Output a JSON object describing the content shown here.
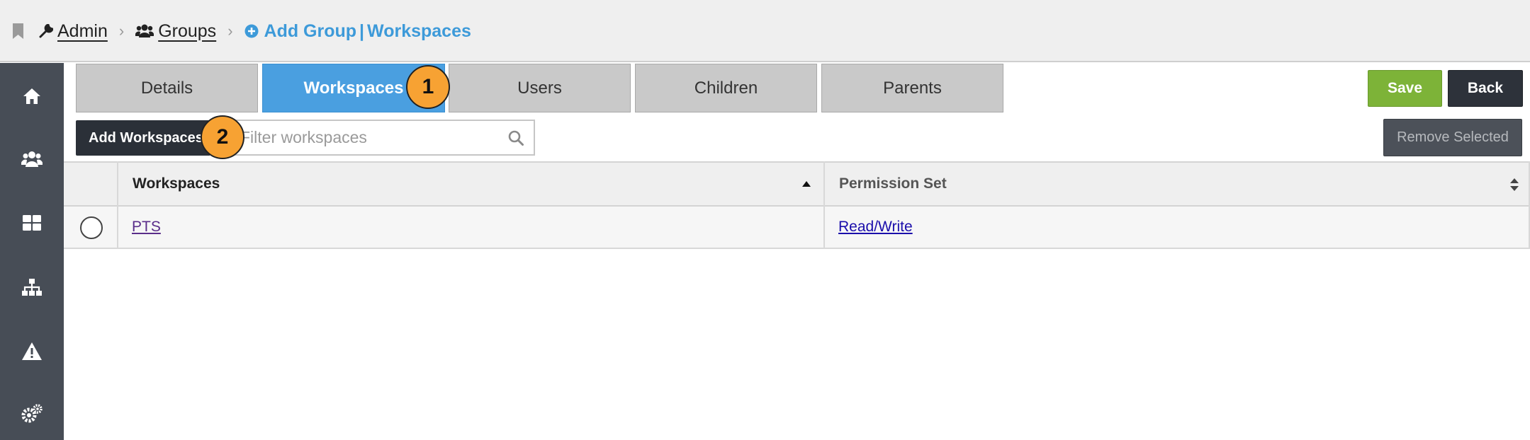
{
  "breadcrumb": {
    "admin": "Admin",
    "groups": "Groups",
    "current_action": "Add Group",
    "current_separator": "|",
    "current_section": "Workspaces"
  },
  "sidebar": {
    "items": [
      {
        "icon": "home-icon"
      },
      {
        "icon": "users-icon"
      },
      {
        "icon": "dashboard-grid-icon"
      },
      {
        "icon": "sitemap-icon"
      },
      {
        "icon": "warning-icon"
      },
      {
        "icon": "settings-icon"
      }
    ]
  },
  "tabs": [
    {
      "label": "Details",
      "active": false
    },
    {
      "label": "Workspaces",
      "active": true
    },
    {
      "label": "Users",
      "active": false
    },
    {
      "label": "Children",
      "active": false
    },
    {
      "label": "Parents",
      "active": false
    }
  ],
  "actions": {
    "save": "Save",
    "back": "Back",
    "add_workspaces": "Add Workspaces",
    "remove_selected": "Remove Selected"
  },
  "filter": {
    "placeholder": "Filter workspaces",
    "value": ""
  },
  "markers": [
    "1",
    "2"
  ],
  "table": {
    "columns": [
      "Workspaces",
      "Permission Set"
    ],
    "rows": [
      {
        "workspace": "PTS",
        "permission_set": "Read/Write"
      }
    ]
  },
  "colors": {
    "active_tab": "#4a9fe0",
    "save": "#7db338",
    "dark_button": "#2d323a",
    "sidebar": "#474d56",
    "breadcrumb_current": "#3d9ad9",
    "marker": "#f7a233"
  }
}
